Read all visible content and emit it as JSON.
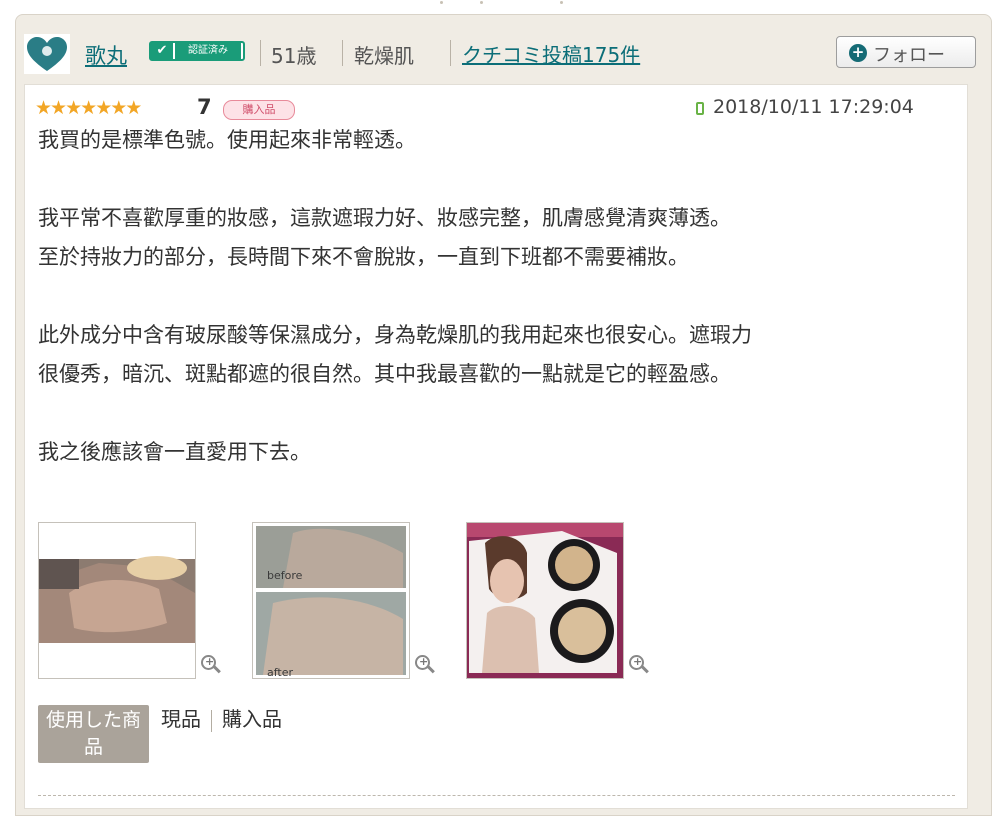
{
  "reviewer": {
    "avatar_icon": "heart-logo-icon",
    "name": "歌丸",
    "verified_badge": "認証済み",
    "age": "51歳",
    "skin_type": "乾燥肌",
    "posts_link": "クチコミ投稿175件",
    "follow_label": "フォロー"
  },
  "review": {
    "stars_filled": 7,
    "stars_total": 7,
    "rating": "7",
    "purchase_badge": "購入品",
    "device_icon": "mobile-phone-icon",
    "datetime": "2018/10/11 17:29:04",
    "paragraphs": [
      "我買的是標準色號。使用起來非常輕透。",
      "我平常不喜歡厚重的妝感，這款遮瑕力好、妝感完整，肌膚感覺清爽薄透。\n至於持妝力的部分，長時間下來不會脫妝，一直到下班都不需要補妝。",
      "此外成分中含有玻尿酸等保濕成分，身為乾燥肌的我用起來也很安心。遮瑕力\n很優秀，暗沉、斑點都遮的很自然。其中我最喜歡的一點就是它的輕盈感。",
      "我之後應該會一直愛用下去。"
    ],
    "photos": [
      {
        "name": "hand-swatch-photo",
        "caption_top": "",
        "caption_bottom": ""
      },
      {
        "name": "before-after-photo",
        "caption_top": "before",
        "caption_bottom": "after"
      },
      {
        "name": "product-compact-photo",
        "caption_top": "",
        "caption_bottom": ""
      }
    ],
    "used_product_label": "使用した商品",
    "used_product_values": [
      "現品",
      "購入品"
    ]
  },
  "colors": {
    "link": "#0c6e78",
    "badge_green": "#1a9c79",
    "star": "#f2a626",
    "panel_bg": "#f0ece4"
  }
}
